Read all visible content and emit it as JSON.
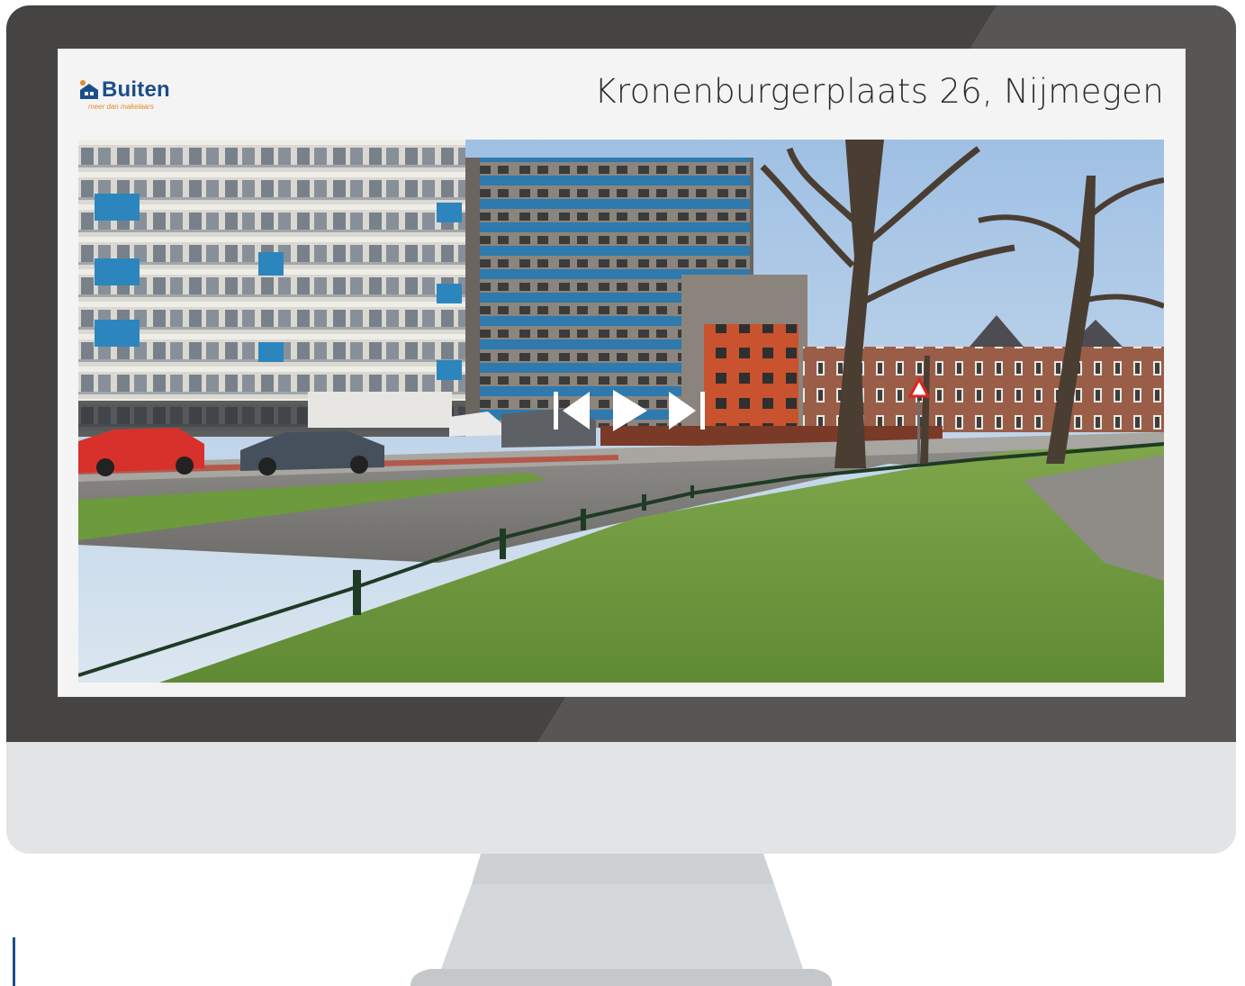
{
  "listing": {
    "brand_name": "Buiten",
    "brand_tagline": "meer dan makelaars",
    "title": "Kronenburgerplaats 26, Nijmegen"
  },
  "viewer": {
    "photo_alt": "Straatbeeld Kronenburgerplaats, Nijmegen",
    "controls": {
      "previous_icon": "skip-previous-icon",
      "play_icon": "play-icon",
      "next_icon": "skip-next-icon"
    }
  },
  "colors": {
    "bezel": "#454442",
    "chin": "#e3e4e6",
    "brand_blue": "#1b4f8a",
    "brand_orange": "#e58a2a"
  }
}
